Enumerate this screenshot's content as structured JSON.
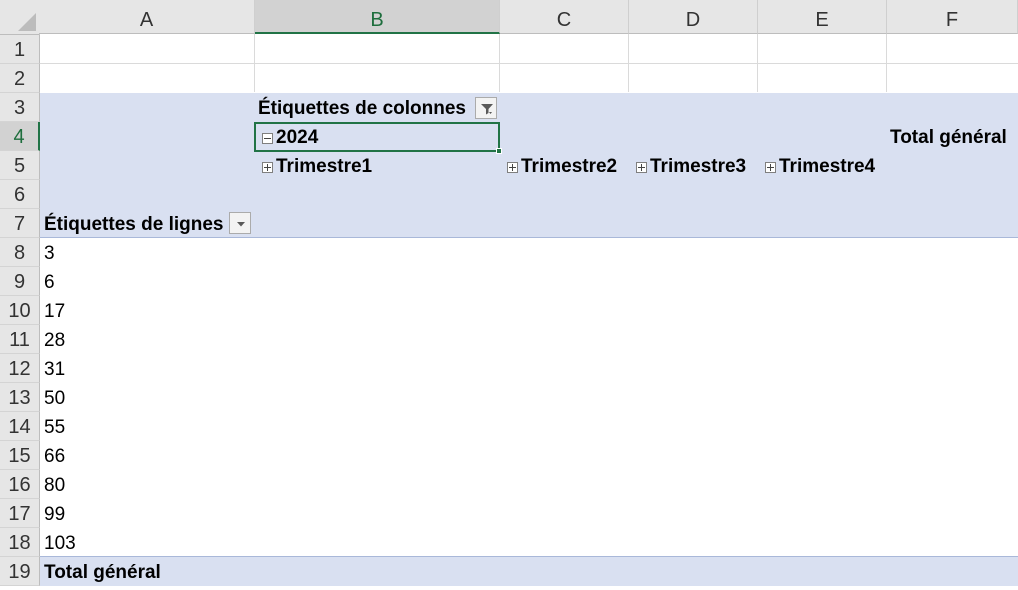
{
  "columns": [
    "A",
    "B",
    "C",
    "D",
    "E",
    "F"
  ],
  "selected_column": "B",
  "rows": [
    "1",
    "2",
    "3",
    "4",
    "5",
    "6",
    "7",
    "8",
    "9",
    "10",
    "11",
    "12",
    "13",
    "14",
    "15",
    "16",
    "17",
    "18",
    "19"
  ],
  "selected_row": "4",
  "pivot": {
    "column_labels_header": "Étiquettes de colonnes",
    "year": "2024",
    "grand_total_col": "Total général",
    "quarters": [
      "Trimestre1",
      "Trimestre2",
      "Trimestre3",
      "Trimestre4"
    ],
    "row_labels_header": "Étiquettes de lignes",
    "row_values": [
      "3",
      "6",
      "17",
      "28",
      "31",
      "50",
      "55",
      "66",
      "80",
      "99",
      "103"
    ],
    "grand_total_row": "Total général"
  },
  "colors": {
    "pivot_band": "#d9e0f1",
    "selection": "#217346"
  },
  "icons": {
    "column_filter": "filter-dropdown-icon",
    "row_filter": "dropdown-arrow-icon",
    "collapse": "minus-box-icon",
    "expand": "plus-box-icon"
  }
}
